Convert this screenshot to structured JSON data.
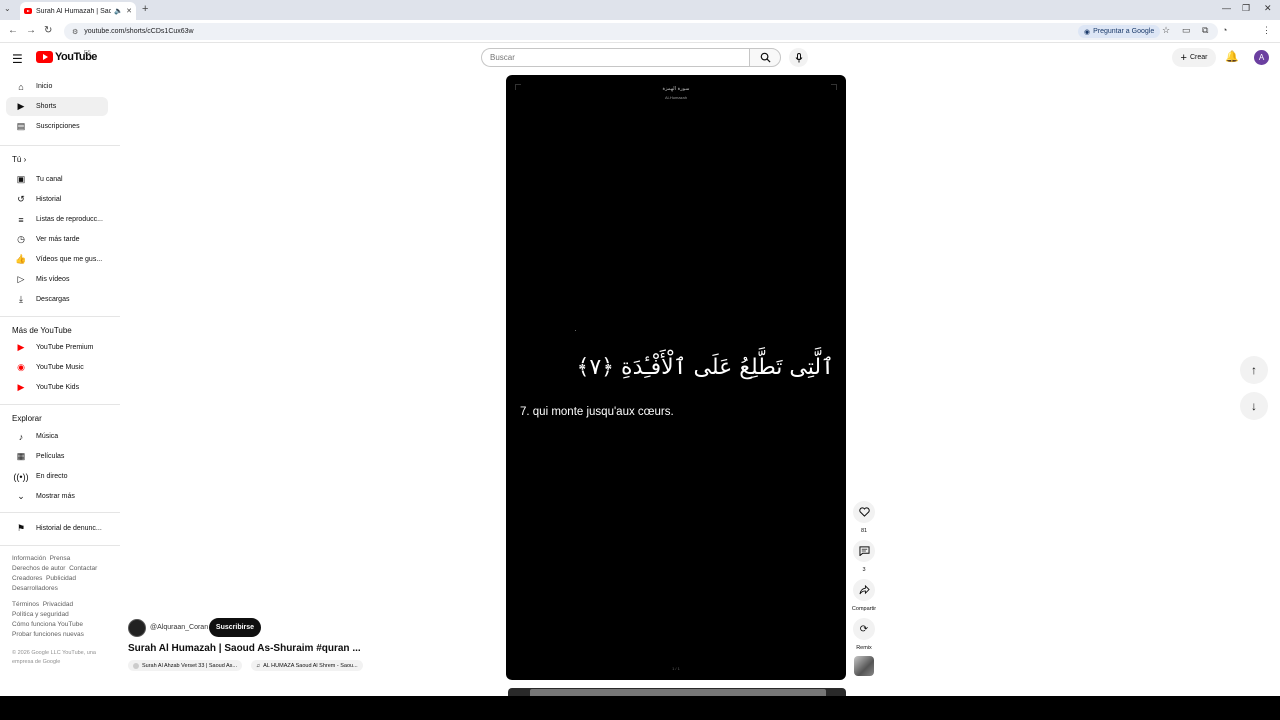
{
  "browser": {
    "tab_title": "Surah Al Humazah | Saoud",
    "url": "youtube.com/shorts/cCDs1Cux63w",
    "ask_google": "Preguntar a Google"
  },
  "header": {
    "logo_text": "YouTube",
    "country_code": "ES",
    "search_placeholder": "Buscar",
    "create_label": "Crear",
    "avatar_letter": "A"
  },
  "sidebar": {
    "main": [
      {
        "label": "Inicio",
        "icon": "home-icon"
      },
      {
        "label": "Shorts",
        "icon": "shorts-icon"
      },
      {
        "label": "Suscripciones",
        "icon": "subscriptions-icon"
      }
    ],
    "you_heading": "Tú",
    "you": [
      {
        "label": "Tu canal"
      },
      {
        "label": "Historial"
      },
      {
        "label": "Listas de reproducc..."
      },
      {
        "label": "Ver más tarde"
      },
      {
        "label": "Vídeos que me gus..."
      },
      {
        "label": "Mis vídeos"
      },
      {
        "label": "Descargas"
      }
    ],
    "more_heading": "Más de YouTube",
    "more": [
      {
        "label": "YouTube Premium"
      },
      {
        "label": "YouTube Music"
      },
      {
        "label": "YouTube Kids"
      }
    ],
    "explore_heading": "Explorar",
    "explore": [
      {
        "label": "Música"
      },
      {
        "label": "Películas"
      },
      {
        "label": "En directo"
      },
      {
        "label": "Mostrar más"
      }
    ],
    "report_history": "Historial de denunc...",
    "footer": {
      "line1a": "Información",
      "line1b": "Prensa",
      "line2a": "Derechos de autor",
      "line2b": "Contactar",
      "line3a": "Creadores",
      "line3b": "Publicidad",
      "line4": "Desarrolladores",
      "line5a": "Términos",
      "line5b": "Privacidad",
      "line6": "Política y seguridad",
      "line7": "Cómo funciona YouTube",
      "line8": "Probar funciones nuevas",
      "copyright": "© 2026 Google LLC YouTube, una empresa de Google"
    }
  },
  "video": {
    "surah_arabic": "سورة الهمزة",
    "surah_latin": "Al-Humazah",
    "verse_arabic": "ٱلَّتِى تَطَّلِعُ عَلَى ٱلْأَفْـِٔدَةِ ﴿٧﴾",
    "verse_translation": "7. qui monte jusqu'aux cœurs.",
    "page_indicator": "1 / 1",
    "channel": "@Alquraan_Coran",
    "subscribe": "Suscribirse",
    "title": "Surah Al Humazah | Saoud As-Shuraim #quran ...",
    "chip1": "Surah Al Ahzab Verset 33 | Saoud As...",
    "chip2": "AL HUMAZA Saoud Al Shrem - Saou..."
  },
  "actions": {
    "likes": "81",
    "comments": "3",
    "share": "Compartir",
    "remix": "Remix"
  }
}
